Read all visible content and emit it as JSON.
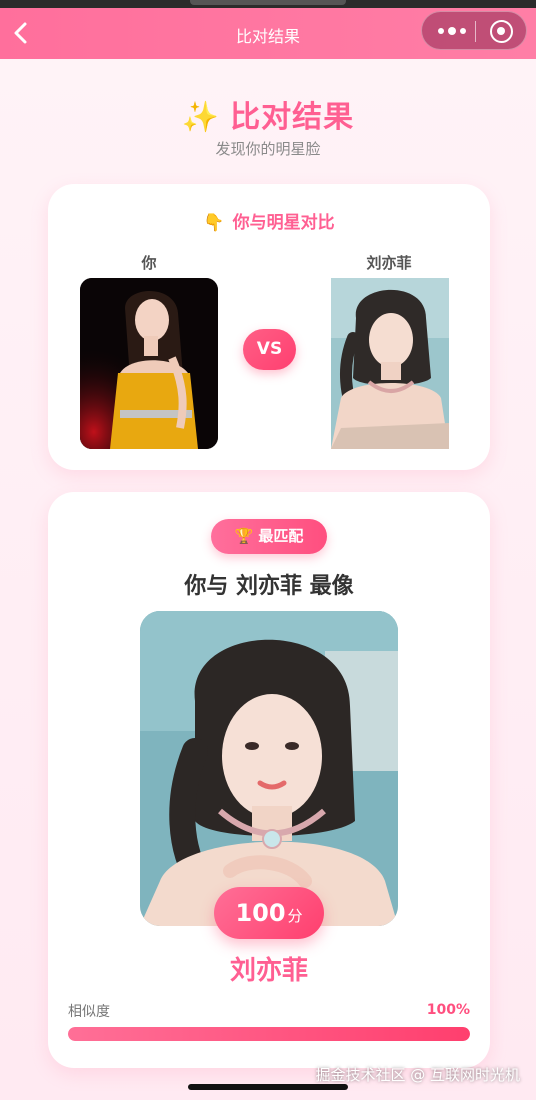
{
  "nav": {
    "title": "比对结果"
  },
  "hero": {
    "title": "比对结果",
    "subtitle": "发现你的明星脸"
  },
  "compare_card": {
    "title": "你与明星对比",
    "you_label": "你",
    "star_label": "刘亦菲",
    "vs_text": "VS"
  },
  "result_card": {
    "badge": "最匹配",
    "headline": "你与 刘亦菲 最像",
    "score": "100",
    "score_unit": "分",
    "star_name": "刘亦菲",
    "similarity_label": "相似度",
    "similarity_value": "100%",
    "similarity_fraction": 1.0
  },
  "watermark": "掘金技术社区 @ 互联网时光机",
  "colors": {
    "accent": "#ff5f92",
    "nav": "#ff7ea6",
    "badge_gold": "#ffc12d"
  },
  "icons": [
    "back-arrow-icon",
    "more-dots-icon",
    "close-circle-icon",
    "sparkle-icon",
    "pointing-hand-icon",
    "trophy-icon"
  ]
}
